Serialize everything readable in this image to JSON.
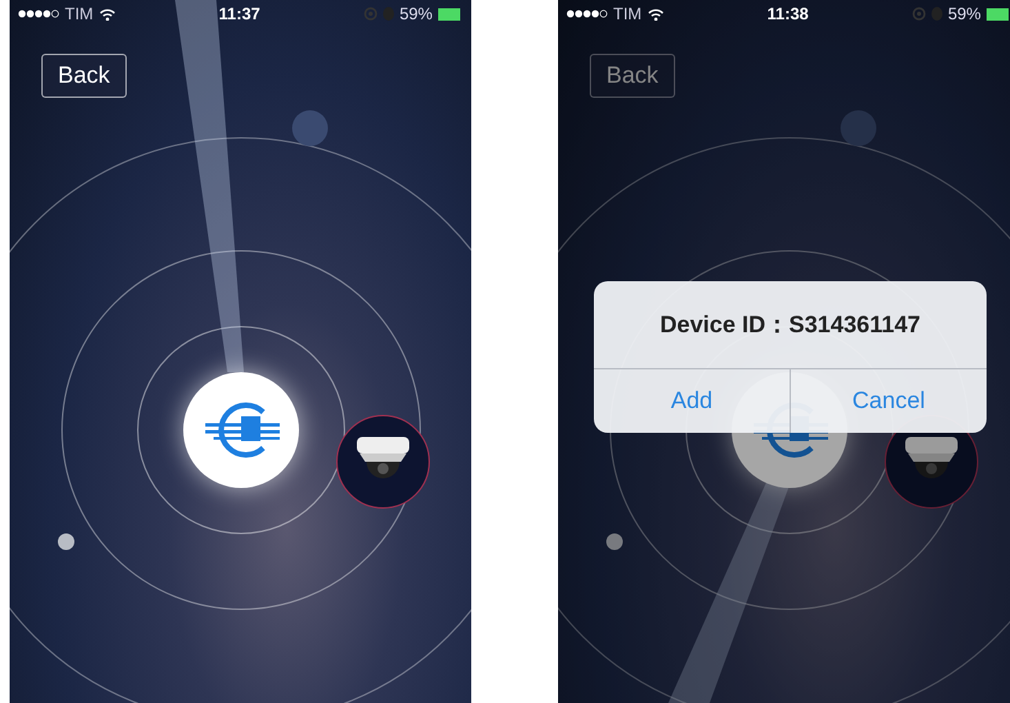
{
  "screens": [
    {
      "status_bar": {
        "carrier": "TIM",
        "time": "11:37",
        "battery": "59%"
      },
      "back_button": "Back"
    },
    {
      "status_bar": {
        "carrier": "TIM",
        "time": "11:38",
        "battery": "59%"
      },
      "back_button": "Back",
      "alert": {
        "message": "Device ID：S314361147",
        "buttons": [
          "Add",
          "Cancel"
        ]
      }
    }
  ]
}
